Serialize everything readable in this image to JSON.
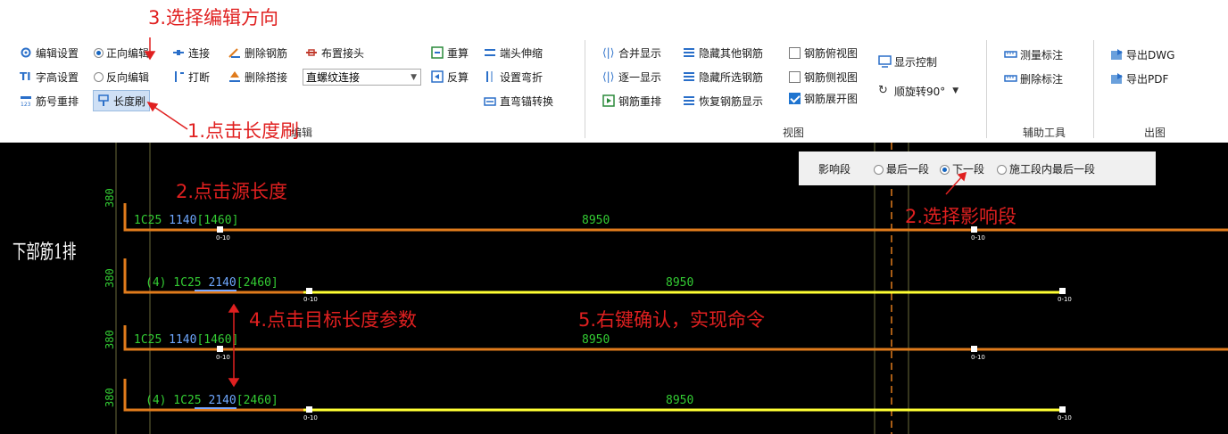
{
  "ribbon": {
    "group1": {
      "edit_settings": "编辑设置",
      "text_height": "字高设置",
      "renumber": "筋号重排",
      "forward_edit": "正向编辑",
      "reverse_edit": "反向编辑",
      "length_brush": "长度刷",
      "connect": "连接",
      "break": "打断",
      "delete_rebar": "删除钢筋",
      "delete_lap": "删除搭接",
      "place_joint": "布置接头",
      "joint_type": "直螺纹连接",
      "recalc": "重算",
      "back_calc": "反算",
      "end_stretch": "端头伸缩",
      "set_bend": "设置弯折",
      "straight_bend_anchor": "直弯锚转换",
      "label": "编辑"
    },
    "group2": {
      "merge_display": "合并显示",
      "one_by_one": "逐一显示",
      "rebar_renumber": "钢筋重排",
      "hide_other": "隐藏其他钢筋",
      "hide_selected": "隐藏所选钢筋",
      "restore_display": "恢复钢筋显示",
      "top_view": "钢筋俯视图",
      "side_view": "钢筋侧视图",
      "unfold_view": "钢筋展开图",
      "display_control": "显示控制",
      "rotate": "顺旋转90°",
      "label": "视图"
    },
    "group3": {
      "measure": "测量标注",
      "delete_label": "删除标注",
      "label": "辅助工具"
    },
    "group4": {
      "export_dwg": "导出DWG",
      "export_pdf": "导出PDF",
      "label": "出图"
    }
  },
  "influence_panel": {
    "label": "影响段",
    "opt_last": "最后一段",
    "opt_next": "下一段",
    "opt_stage_last": "施工段内最后一段"
  },
  "cad": {
    "row_title": "下部筋1排",
    "rows": [
      {
        "vert": "380",
        "spec": "1C25",
        "len1": "1140",
        "len2": "[1460]",
        "mid": "8950"
      },
      {
        "vert": "380",
        "spec": "(4) 1C25",
        "len1": "2140",
        "len2": "[2460]",
        "mid": "8950"
      },
      {
        "vert": "380",
        "spec": "1C25",
        "len1": "1140",
        "len2": "[1460]",
        "mid": "8950"
      },
      {
        "vert": "380",
        "spec": "(4) 1C25",
        "len1": "2140",
        "len2": "[2460]",
        "mid": "8950"
      }
    ],
    "marker_small": "0-10"
  },
  "annotations": {
    "step3": "3.选择编辑方向",
    "step1": "1.点击长度刷",
    "step2a": "2.点击源长度",
    "step2b": "2.选择影响段",
    "step4": "4.点击目标长度参数",
    "step5": "5.右键确认，实现命令"
  },
  "colors": {
    "orange": "#e07b1c",
    "yellow": "#ffff33",
    "green": "#33cc33",
    "blue_text": "#6fa8ff",
    "annotation_red": "#e02020"
  }
}
